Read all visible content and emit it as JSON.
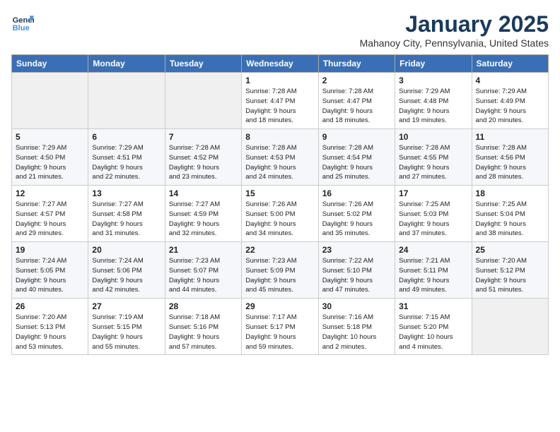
{
  "header": {
    "logo_line1": "General",
    "logo_line2": "Blue",
    "month_title": "January 2025",
    "subtitle": "Mahanoy City, Pennsylvania, United States"
  },
  "weekdays": [
    "Sunday",
    "Monday",
    "Tuesday",
    "Wednesday",
    "Thursday",
    "Friday",
    "Saturday"
  ],
  "weeks": [
    [
      {
        "day": "",
        "info": ""
      },
      {
        "day": "",
        "info": ""
      },
      {
        "day": "",
        "info": ""
      },
      {
        "day": "1",
        "info": "Sunrise: 7:28 AM\nSunset: 4:47 PM\nDaylight: 9 hours\nand 18 minutes."
      },
      {
        "day": "2",
        "info": "Sunrise: 7:28 AM\nSunset: 4:47 PM\nDaylight: 9 hours\nand 18 minutes."
      },
      {
        "day": "3",
        "info": "Sunrise: 7:29 AM\nSunset: 4:48 PM\nDaylight: 9 hours\nand 19 minutes."
      },
      {
        "day": "4",
        "info": "Sunrise: 7:29 AM\nSunset: 4:49 PM\nDaylight: 9 hours\nand 20 minutes."
      }
    ],
    [
      {
        "day": "5",
        "info": "Sunrise: 7:29 AM\nSunset: 4:50 PM\nDaylight: 9 hours\nand 21 minutes."
      },
      {
        "day": "6",
        "info": "Sunrise: 7:29 AM\nSunset: 4:51 PM\nDaylight: 9 hours\nand 22 minutes."
      },
      {
        "day": "7",
        "info": "Sunrise: 7:28 AM\nSunset: 4:52 PM\nDaylight: 9 hours\nand 23 minutes."
      },
      {
        "day": "8",
        "info": "Sunrise: 7:28 AM\nSunset: 4:53 PM\nDaylight: 9 hours\nand 24 minutes."
      },
      {
        "day": "9",
        "info": "Sunrise: 7:28 AM\nSunset: 4:54 PM\nDaylight: 9 hours\nand 25 minutes."
      },
      {
        "day": "10",
        "info": "Sunrise: 7:28 AM\nSunset: 4:55 PM\nDaylight: 9 hours\nand 27 minutes."
      },
      {
        "day": "11",
        "info": "Sunrise: 7:28 AM\nSunset: 4:56 PM\nDaylight: 9 hours\nand 28 minutes."
      }
    ],
    [
      {
        "day": "12",
        "info": "Sunrise: 7:27 AM\nSunset: 4:57 PM\nDaylight: 9 hours\nand 29 minutes."
      },
      {
        "day": "13",
        "info": "Sunrise: 7:27 AM\nSunset: 4:58 PM\nDaylight: 9 hours\nand 31 minutes."
      },
      {
        "day": "14",
        "info": "Sunrise: 7:27 AM\nSunset: 4:59 PM\nDaylight: 9 hours\nand 32 minutes."
      },
      {
        "day": "15",
        "info": "Sunrise: 7:26 AM\nSunset: 5:00 PM\nDaylight: 9 hours\nand 34 minutes."
      },
      {
        "day": "16",
        "info": "Sunrise: 7:26 AM\nSunset: 5:02 PM\nDaylight: 9 hours\nand 35 minutes."
      },
      {
        "day": "17",
        "info": "Sunrise: 7:25 AM\nSunset: 5:03 PM\nDaylight: 9 hours\nand 37 minutes."
      },
      {
        "day": "18",
        "info": "Sunrise: 7:25 AM\nSunset: 5:04 PM\nDaylight: 9 hours\nand 38 minutes."
      }
    ],
    [
      {
        "day": "19",
        "info": "Sunrise: 7:24 AM\nSunset: 5:05 PM\nDaylight: 9 hours\nand 40 minutes."
      },
      {
        "day": "20",
        "info": "Sunrise: 7:24 AM\nSunset: 5:06 PM\nDaylight: 9 hours\nand 42 minutes."
      },
      {
        "day": "21",
        "info": "Sunrise: 7:23 AM\nSunset: 5:07 PM\nDaylight: 9 hours\nand 44 minutes."
      },
      {
        "day": "22",
        "info": "Sunrise: 7:23 AM\nSunset: 5:09 PM\nDaylight: 9 hours\nand 45 minutes."
      },
      {
        "day": "23",
        "info": "Sunrise: 7:22 AM\nSunset: 5:10 PM\nDaylight: 9 hours\nand 47 minutes."
      },
      {
        "day": "24",
        "info": "Sunrise: 7:21 AM\nSunset: 5:11 PM\nDaylight: 9 hours\nand 49 minutes."
      },
      {
        "day": "25",
        "info": "Sunrise: 7:20 AM\nSunset: 5:12 PM\nDaylight: 9 hours\nand 51 minutes."
      }
    ],
    [
      {
        "day": "26",
        "info": "Sunrise: 7:20 AM\nSunset: 5:13 PM\nDaylight: 9 hours\nand 53 minutes."
      },
      {
        "day": "27",
        "info": "Sunrise: 7:19 AM\nSunset: 5:15 PM\nDaylight: 9 hours\nand 55 minutes."
      },
      {
        "day": "28",
        "info": "Sunrise: 7:18 AM\nSunset: 5:16 PM\nDaylight: 9 hours\nand 57 minutes."
      },
      {
        "day": "29",
        "info": "Sunrise: 7:17 AM\nSunset: 5:17 PM\nDaylight: 9 hours\nand 59 minutes."
      },
      {
        "day": "30",
        "info": "Sunrise: 7:16 AM\nSunset: 5:18 PM\nDaylight: 10 hours\nand 2 minutes."
      },
      {
        "day": "31",
        "info": "Sunrise: 7:15 AM\nSunset: 5:20 PM\nDaylight: 10 hours\nand 4 minutes."
      },
      {
        "day": "",
        "info": ""
      }
    ]
  ]
}
